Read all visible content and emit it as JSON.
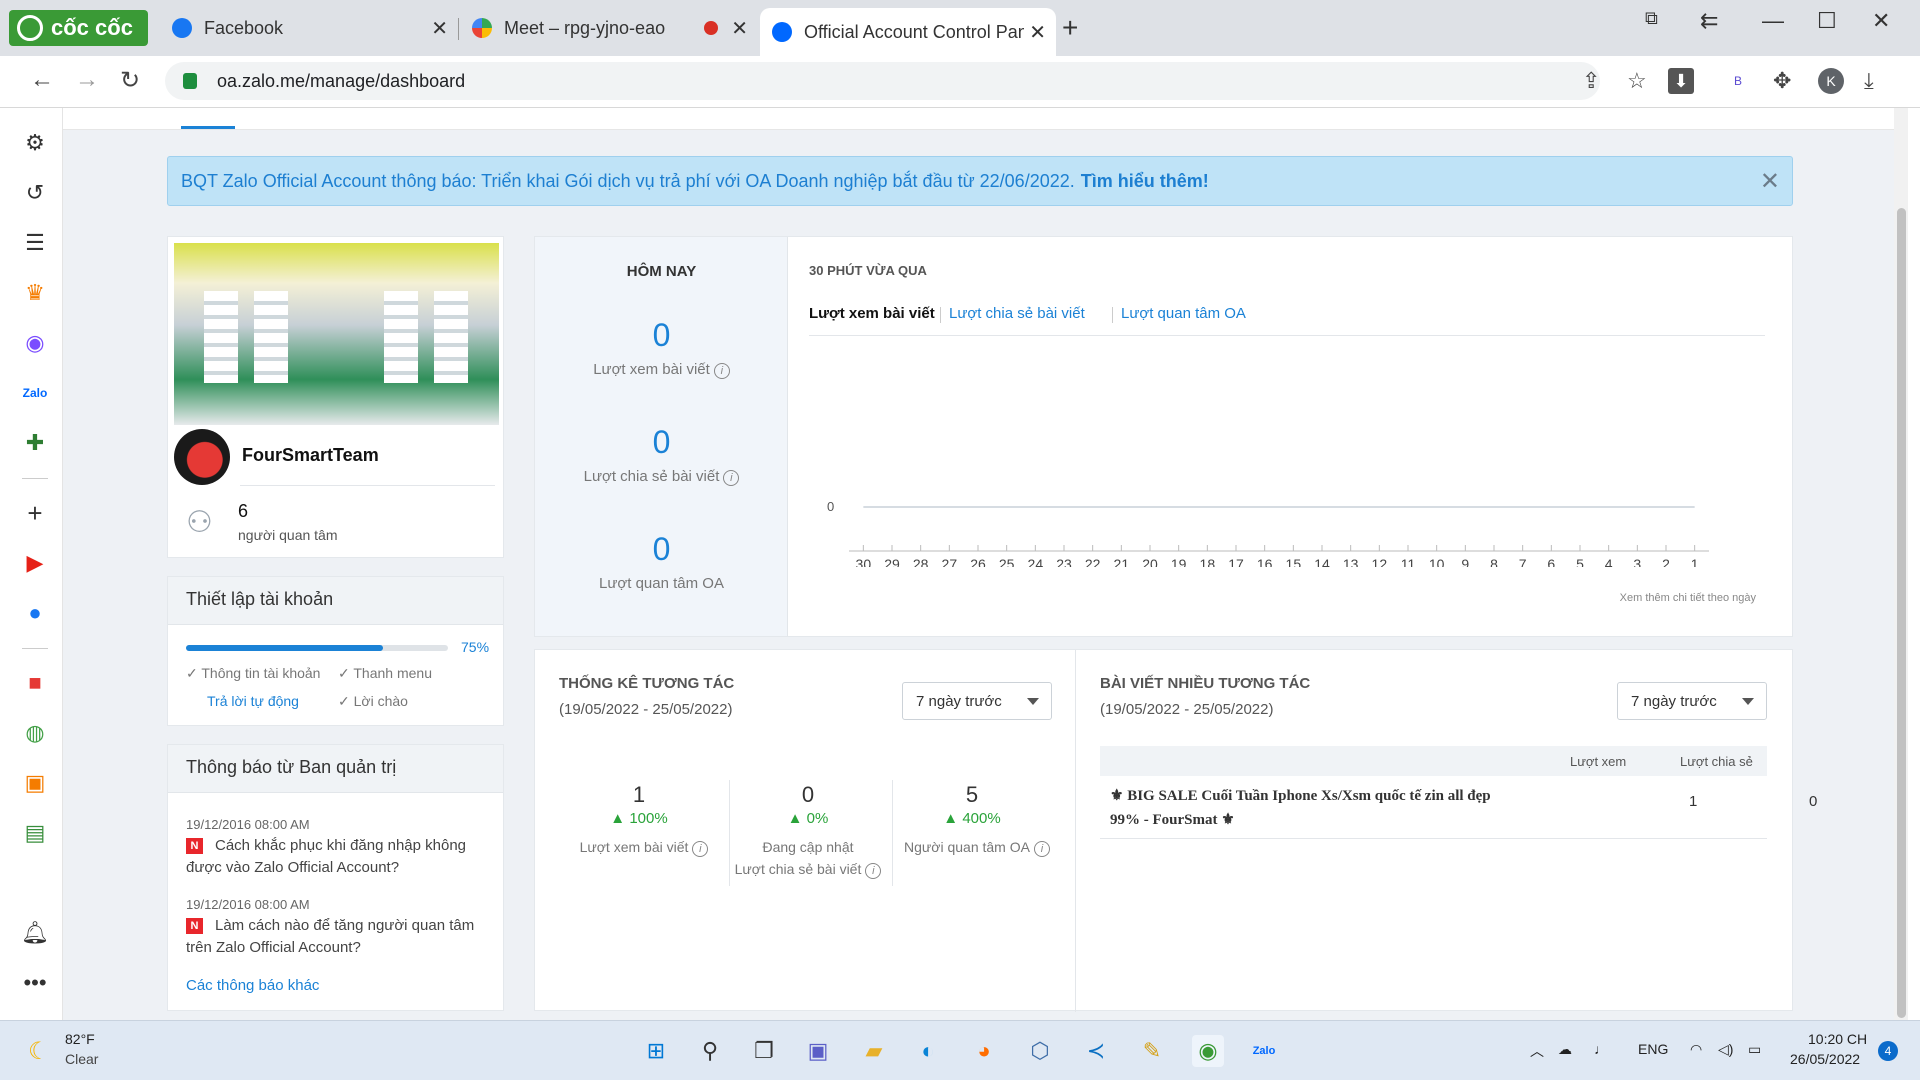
{
  "browser": {
    "brand": "cốc cốc",
    "tabs": [
      {
        "label": "Facebook"
      },
      {
        "label": "Meet – rpg-yjno-eao"
      },
      {
        "label": "Official Account Control Panel"
      }
    ],
    "url": "oa.zalo.me/manage/dashboard",
    "profile_initial": "K",
    "ext_badge": "B"
  },
  "notice": {
    "text": "BQT Zalo Official Account thông báo: Triển khai Gói dịch vụ trả phí với OA Doanh nghiệp bắt đầu từ 22/06/2022.",
    "link": "Tìm hiểu thêm!"
  },
  "profile": {
    "name": "FourSmartTeam",
    "followers": "6",
    "followers_label": "người quan tâm"
  },
  "setup": {
    "title": "Thiết lập tài khoản",
    "progress_pct": 75,
    "progress_label": "75%",
    "items": [
      "Thông tin tài khoản",
      "Thanh menu",
      "Trả lời tự động",
      "Lời chào"
    ]
  },
  "admin_notices": {
    "title": "Thông báo từ Ban quản trị",
    "items": [
      {
        "date": "19/12/2016 08:00 AM",
        "badge": "N",
        "text": "Cách khắc phục khi đăng nhập không được vào Zalo Official Account?"
      },
      {
        "date": "19/12/2016 08:00 AM",
        "badge": "N",
        "text": "Làm cách nào để tăng người quan tâm trên Zalo Official Account?"
      }
    ],
    "more": "Các thông báo khác"
  },
  "today": {
    "title": "HÔM NAY",
    "stats": [
      {
        "value": "0",
        "label": "Lượt xem bài viết"
      },
      {
        "value": "0",
        "label": "Lượt chia sẻ bài viết"
      },
      {
        "value": "0",
        "label": "Lượt quan tâm OA"
      }
    ]
  },
  "recent": {
    "title": "30 PHÚT VỪA QUA",
    "tabs": [
      "Lượt xem bài viết",
      "Lượt chia sẻ bài viết",
      "Lượt quan tâm OA"
    ],
    "note": "Xem thêm chi tiết theo ngày"
  },
  "chart_data": {
    "type": "line",
    "x": [
      "30",
      "29",
      "28",
      "27",
      "26",
      "25",
      "24",
      "23",
      "22",
      "21",
      "20",
      "19",
      "18",
      "17",
      "16",
      "15",
      "14",
      "13",
      "12",
      "11",
      "10",
      "9",
      "8",
      "7",
      "6",
      "5",
      "4",
      "3",
      "2",
      "1"
    ],
    "series": [
      {
        "values": [
          0,
          0,
          0,
          0,
          0,
          0,
          0,
          0,
          0,
          0,
          0,
          0,
          0,
          0,
          0,
          0,
          0,
          0,
          0,
          0,
          0,
          0,
          0,
          0,
          0,
          0,
          0,
          0,
          0,
          0
        ]
      }
    ],
    "y_ticks": [
      "0"
    ],
    "grid": false
  },
  "interaction": {
    "title": "THỐNG KÊ TƯƠNG TÁC",
    "range": "(19/05/2022 - 25/05/2022)",
    "dropdown": "7 ngày trước",
    "stats": [
      {
        "value": "1",
        "pct": "100%",
        "label": "Lượt xem bài viết"
      },
      {
        "value": "0",
        "pct": "0%",
        "label": "Đang cập nhật\nLượt chia sẻ bài viết"
      },
      {
        "value": "5",
        "pct": "400%",
        "label": "Người quan tâm OA"
      }
    ]
  },
  "top_posts": {
    "title": "BÀI VIẾT NHIỀU TƯƠNG TÁC",
    "range": "(19/05/2022 - 25/05/2022)",
    "dropdown": "7 ngày trước",
    "col_views": "Lượt xem",
    "col_shares": "Lượt chia sẻ",
    "rows": [
      {
        "title": "⚜ BIG SALE Cuối Tuần Iphone Xs/Xsm quốc tế zin all đẹp 99% - FourSmat ⚜",
        "views": "1",
        "shares": "0"
      }
    ]
  },
  "taskbar": {
    "temp": "82°F",
    "weather": "Clear",
    "lang": "ENG",
    "time": "10:20 CH",
    "date": "26/05/2022",
    "notif_count": "4"
  }
}
